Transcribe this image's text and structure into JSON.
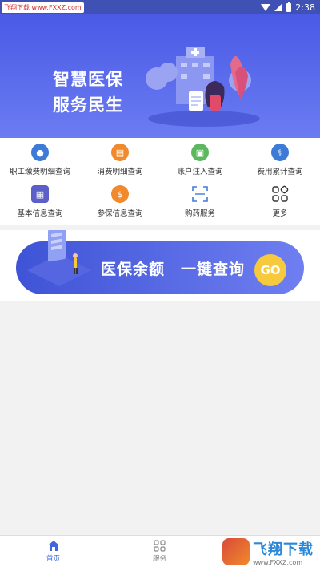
{
  "status_bar": {
    "watermark": "飞翔下载 www.FXXZ.com",
    "time": "2:38"
  },
  "banner": {
    "line1": "智慧医保",
    "line2": "服务民生",
    "slide_count": 2,
    "active_slide": 1
  },
  "services": [
    {
      "label": "职工缴费明细查询",
      "icon": "wallet-icon",
      "color": "#3e7bd6"
    },
    {
      "label": "消费明细查询",
      "icon": "card-icon",
      "color": "#f08a2a"
    },
    {
      "label": "账户注入查询",
      "icon": "deposit-icon",
      "color": "#5cb85c"
    },
    {
      "label": "费用累计查询",
      "icon": "pills-icon",
      "color": "#3e7bd6"
    },
    {
      "label": "基本信息查询",
      "icon": "info-icon",
      "color": "#5b5fc7"
    },
    {
      "label": "参保信息查询",
      "icon": "coin-icon",
      "color": "#f08a2a"
    },
    {
      "label": "购药服务",
      "icon": "scan-icon",
      "color": "#3e7bd6"
    },
    {
      "label": "更多",
      "icon": "more-grid-icon",
      "color": "#333333"
    }
  ],
  "promo": {
    "text": "医保余额　一键查询",
    "button": "GO"
  },
  "bottom_nav": {
    "home": "首页",
    "service": "服务"
  },
  "watermark_bottom": {
    "name": "飞翔下载",
    "url": "www.FXXZ.com"
  }
}
